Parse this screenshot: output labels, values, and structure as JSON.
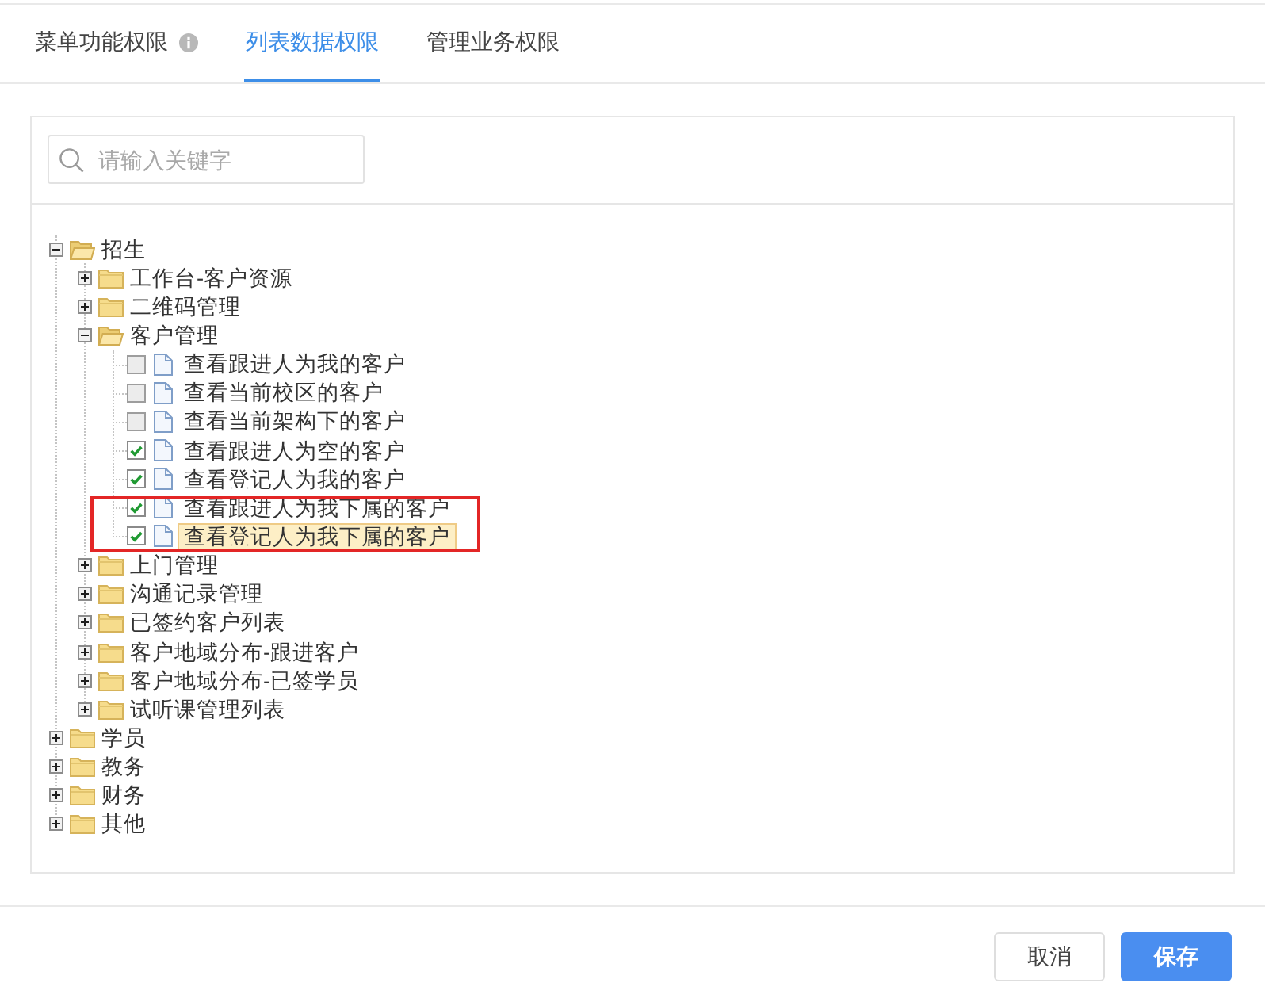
{
  "tabs": [
    {
      "label": "菜单功能权限",
      "selected": false,
      "info": true
    },
    {
      "label": "列表数据权限",
      "selected": true,
      "info": false
    },
    {
      "label": "管理业务权限",
      "selected": false,
      "info": false
    }
  ],
  "search": {
    "placeholder": "请输入关键字"
  },
  "tree": [
    {
      "kind": "folder",
      "label": "招生",
      "expanded": true,
      "selected": false,
      "children": [
        {
          "kind": "folder",
          "label": "工作台-客户资源",
          "expanded": false,
          "selected": false
        },
        {
          "kind": "folder",
          "label": "二维码管理",
          "expanded": false,
          "selected": false
        },
        {
          "kind": "folder",
          "label": "客户管理",
          "expanded": true,
          "selected": false,
          "children": [
            {
              "kind": "leaf",
              "label": "查看跟进人为我的客户",
              "checked": false,
              "selected": false,
              "annotated": false
            },
            {
              "kind": "leaf",
              "label": "查看当前校区的客户",
              "checked": false,
              "selected": false,
              "annotated": false
            },
            {
              "kind": "leaf",
              "label": "查看当前架构下的客户",
              "checked": false,
              "selected": false,
              "annotated": false
            },
            {
              "kind": "leaf",
              "label": "查看跟进人为空的客户",
              "checked": true,
              "selected": false,
              "annotated": false
            },
            {
              "kind": "leaf",
              "label": "查看登记人为我的客户",
              "checked": true,
              "selected": false,
              "annotated": false
            },
            {
              "kind": "leaf",
              "label": "查看跟进人为我下属的客户",
              "checked": true,
              "selected": false,
              "annotated": true
            },
            {
              "kind": "leaf",
              "label": "查看登记人为我下属的客户",
              "checked": true,
              "selected": true,
              "annotated": true
            }
          ]
        },
        {
          "kind": "folder",
          "label": "上门管理",
          "expanded": false,
          "selected": false
        },
        {
          "kind": "folder",
          "label": "沟通记录管理",
          "expanded": false,
          "selected": false
        },
        {
          "kind": "folder",
          "label": "已签约客户列表",
          "expanded": false,
          "selected": false
        },
        {
          "kind": "folder",
          "label": "客户地域分布-跟进客户",
          "expanded": false,
          "selected": false
        },
        {
          "kind": "folder",
          "label": "客户地域分布-已签学员",
          "expanded": false,
          "selected": false
        },
        {
          "kind": "folder",
          "label": "试听课管理列表",
          "expanded": false,
          "selected": false
        }
      ]
    },
    {
      "kind": "folder",
      "label": "学员",
      "expanded": false,
      "selected": false
    },
    {
      "kind": "folder",
      "label": "教务",
      "expanded": false,
      "selected": false
    },
    {
      "kind": "folder",
      "label": "财务",
      "expanded": false,
      "selected": false
    },
    {
      "kind": "folder",
      "label": "其他",
      "expanded": false,
      "selected": false
    }
  ],
  "buttons": [
    {
      "kind": "secondary",
      "label": "取消"
    },
    {
      "kind": "primary",
      "label": "保存"
    }
  ]
}
